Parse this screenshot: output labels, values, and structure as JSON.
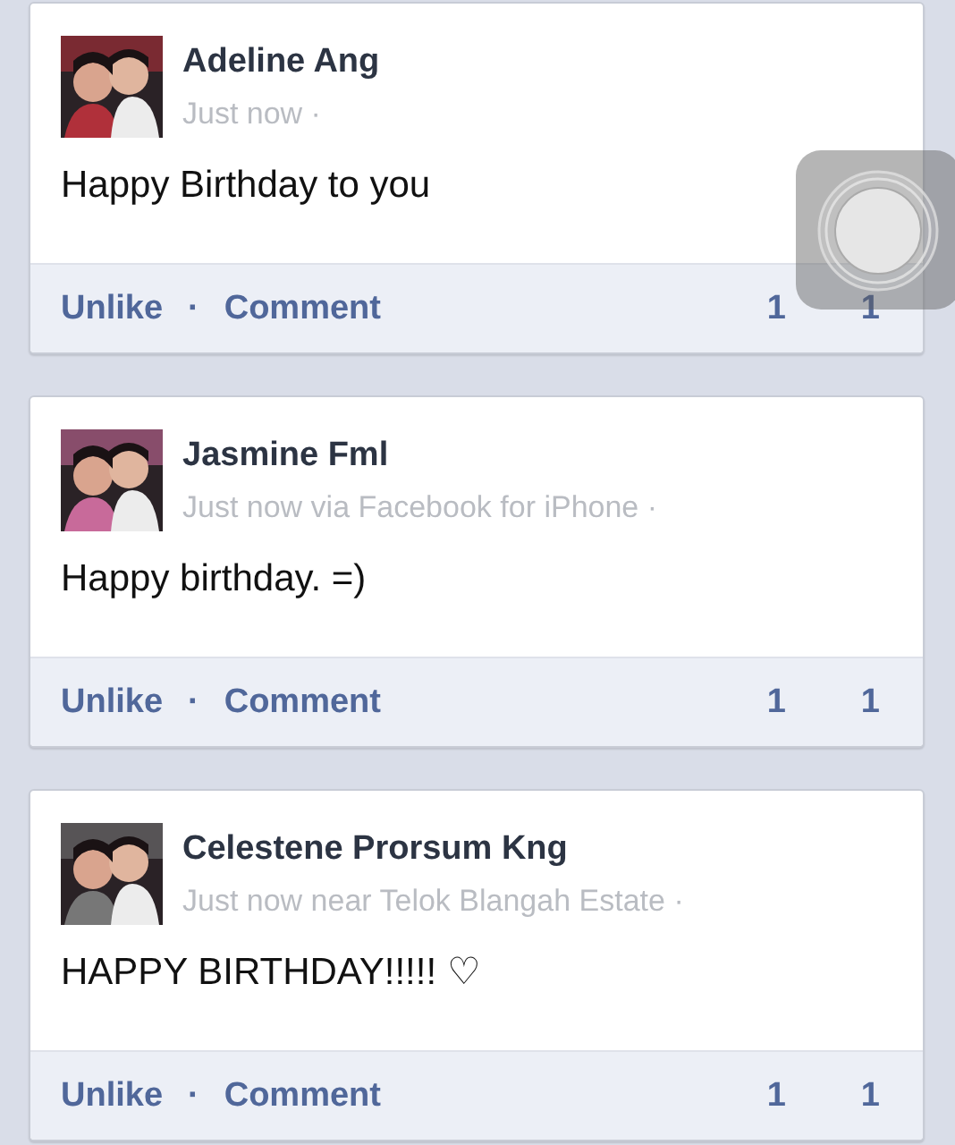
{
  "posts": [
    {
      "author": "Adeline Ang",
      "meta": "Just now ·",
      "message": "Happy Birthday to you",
      "actions": [
        "Unlike",
        "·",
        "Comment"
      ],
      "like_count": "1",
      "comment_count": "1"
    },
    {
      "author": "Jasmine Fml",
      "meta": "Just now via Facebook for iPhone ·",
      "message": "Happy birthday. =)",
      "actions": [
        "Unlike",
        "·",
        "Comment"
      ],
      "like_count": "1",
      "comment_count": "1"
    },
    {
      "author": "Celestene Prorsum Kng",
      "meta": "Just now near Telok Blangah Estate ·",
      "message": "HAPPY BIRTHDAY!!!!! ♡",
      "actions": [
        "Unlike",
        "·",
        "Comment"
      ],
      "like_count": "1",
      "comment_count": "1"
    }
  ]
}
